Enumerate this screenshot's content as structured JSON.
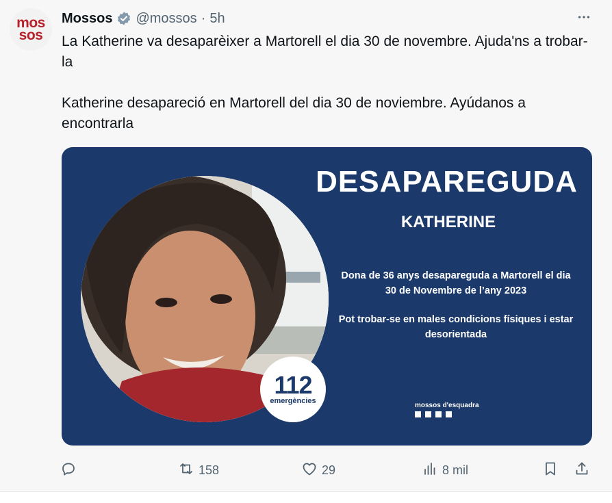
{
  "author": {
    "avatar_text_top": "mos",
    "avatar_text_bottom": "sos",
    "name": "Mossos",
    "handle": "@mossos",
    "separator": "·",
    "time": "5h"
  },
  "tweet_text": "La Katherine va desaparèixer a Martorell el dia 30 de novembre. Ajuda'ns a trobar-la\n\nKatherine desapareció en Martorell del dia 30 de noviembre. Ayúdanos a encontrarla",
  "card": {
    "headline": "DESAPAREGUDA",
    "person_name": "KATHERINE",
    "description_1": "Dona de 36 anys desapareguda a Martorell el dia 30 de Novembre de l’any 2023",
    "description_2": "Pot trobar-se en males condicions físiques i estar desorientada",
    "badge_number": "112",
    "badge_label": "emergències",
    "logo_text": "mossos d'esquadra",
    "background_color": "#1b3a6b"
  },
  "actions": {
    "reply_count": "",
    "retweet_count": "158",
    "like_count": "29",
    "views_count": "8 mil"
  },
  "icons": [
    "verified-badge-icon",
    "more-icon",
    "reply-icon",
    "retweet-icon",
    "like-icon",
    "views-icon",
    "bookmark-icon",
    "share-icon"
  ],
  "colors": {
    "brand_red": "#b8202b",
    "verified": "#829aab",
    "muted": "#536471"
  }
}
